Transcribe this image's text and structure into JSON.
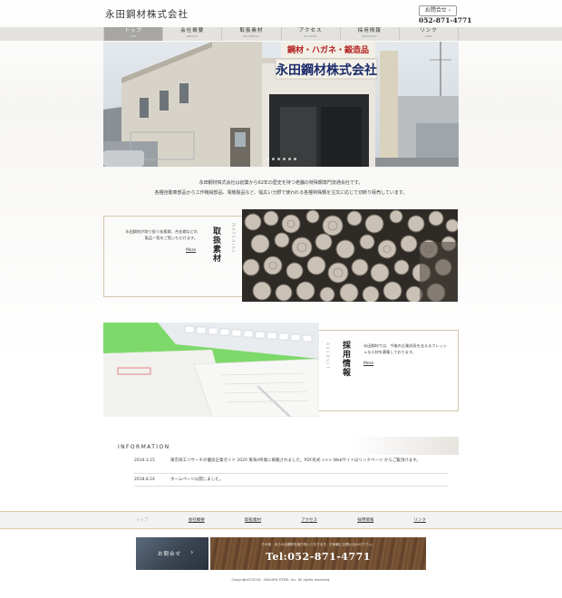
{
  "header": {
    "logo": "永田鋼材株式会社",
    "contact_button": "お問合せ ›",
    "phone": "052-871-4771"
  },
  "nav": {
    "items": [
      {
        "jp": "トップ",
        "en": "TOP"
      },
      {
        "jp": "会社概要",
        "en": "ABOUT"
      },
      {
        "jp": "取扱素材",
        "en": "MATERIAL"
      },
      {
        "jp": "アクセス",
        "en": "ACCESS"
      },
      {
        "jp": "採用情報",
        "en": "RECRUIT"
      },
      {
        "jp": "リンク",
        "en": "LINK"
      }
    ]
  },
  "hero": {
    "sign_top": "鋼材・ハガネ・鍛造品",
    "sign_main": "永田鋼材株式会社"
  },
  "intro": {
    "line1": "永田鋼材株式会社は創業から62年の歴史を持つ老舗の特殊鋼専門流通会社です。",
    "line2": "各種自動車部品から工作機械部品、電機製品など、幅広い分野で使われる各種特殊鋼を注文に応じて切断り販売しています。"
  },
  "material": {
    "text": "永田鋼材が取り扱う炭素鋼、合金鋼などの製品一覧をご覧いただけます。",
    "more": "More",
    "title": "取扱素材",
    "en": "MATERIAL"
  },
  "recruit": {
    "text": "永田鋼材では、今後の企業成長を支えるフレッシュな人材を募集しております。",
    "more": "More",
    "title": "採用情報",
    "en": "RECRUIT"
  },
  "information": {
    "title": "INFORMATION",
    "entries": [
      {
        "date": "2019.3.15",
        "text": "東京商工リサーチの優良企業ガイド 2020 東海4県版に掲載されました。PDF形式 >>> Webサイトはリンクページ からご覧頂けます。"
      },
      {
        "date": "2018.8.24",
        "text": "ホームページ公開しました。"
      }
    ]
  },
  "footer_nav": {
    "items": [
      "トップ",
      "会社概要",
      "取扱素材",
      "アクセス",
      "採用情報",
      "リンク"
    ]
  },
  "footer": {
    "contact": "お問合せ",
    "tel_sub": "その他　あらゆる鋼材を取り扱っております。お気軽にお問い合わせ下さい。",
    "tel": "Tel:052-871-4771",
    "copyright": "Copyright©2018 - NAGATA STEEL inc. All rights reserved."
  },
  "colors": {
    "nav_bg": "#e3e2df",
    "nav_active": "#a7a6a3",
    "frame": "#d3c6ad",
    "recruit_green": "#7dd96a"
  }
}
